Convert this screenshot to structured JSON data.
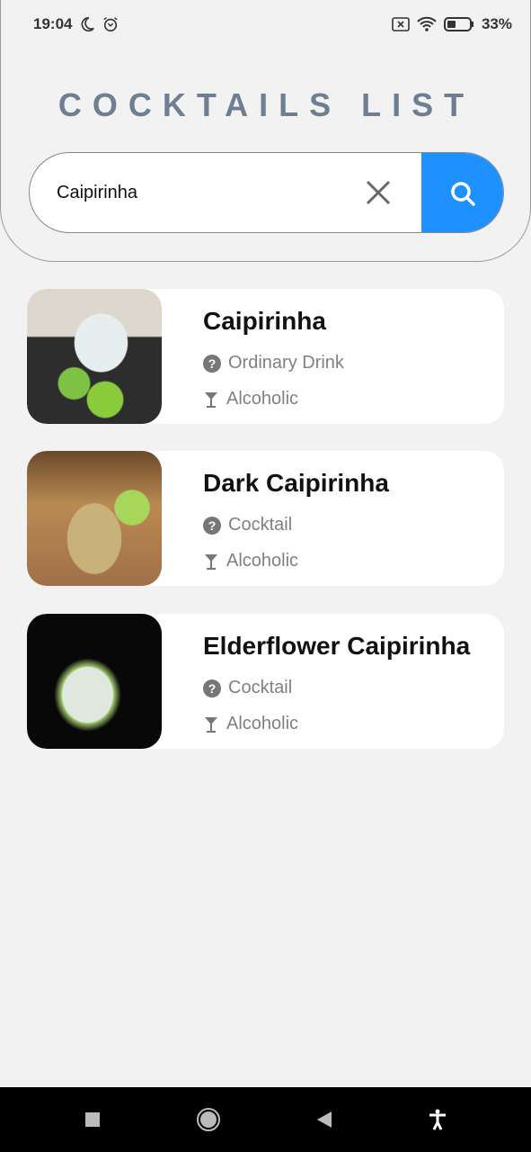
{
  "status": {
    "time": "19:04",
    "battery": "33%"
  },
  "header": {
    "title": "COCKTAILS LIST"
  },
  "search": {
    "value": "Caipirinha"
  },
  "colors": {
    "accent": "#1e90ff",
    "title": "#6d7f91"
  },
  "drinks": [
    {
      "name": "Caipirinha",
      "category": "Ordinary Drink",
      "alcoholic": "Alcoholic"
    },
    {
      "name": "Dark Caipirinha",
      "category": "Cocktail",
      "alcoholic": "Alcoholic"
    },
    {
      "name": "Elderflower Caipirinha",
      "category": "Cocktail",
      "alcoholic": "Alcoholic"
    }
  ]
}
